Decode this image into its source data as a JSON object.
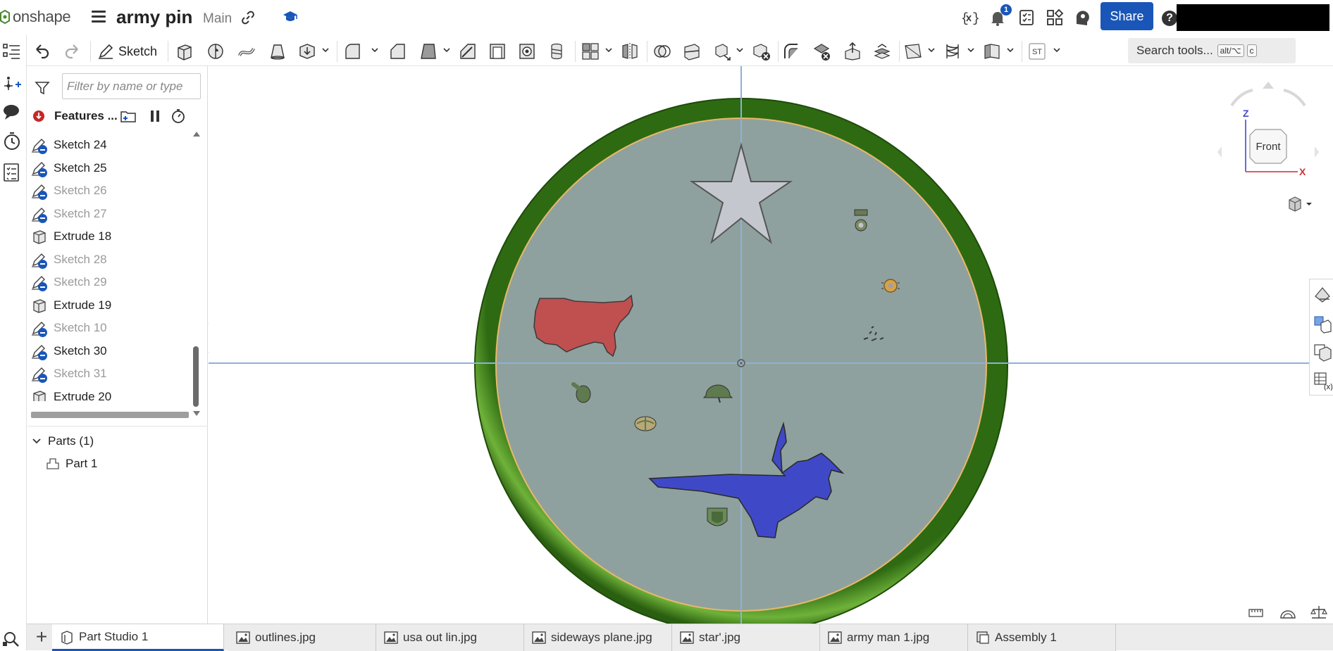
{
  "header": {
    "brand": "onshape",
    "doc_title": "army pin",
    "branch": "Main",
    "notification_count": "1",
    "share_label": "Share",
    "help_label": "?"
  },
  "toolbar": {
    "sketch_label": "Sketch",
    "st_label": "ST",
    "search_label": "Search tools...",
    "search_shortcut_a": "alt/⌥",
    "search_shortcut_b": "c"
  },
  "feature_panel": {
    "filter_placeholder": "Filter by name or type",
    "features_label": "Features ...",
    "items": [
      {
        "label": "Sketch 24",
        "kind": "sketch",
        "suppressed": false
      },
      {
        "label": "Sketch 25",
        "kind": "sketch",
        "suppressed": false
      },
      {
        "label": "Sketch 26",
        "kind": "sketch",
        "suppressed": true
      },
      {
        "label": "Sketch 27",
        "kind": "sketch",
        "suppressed": true
      },
      {
        "label": "Extrude 18",
        "kind": "extrude",
        "suppressed": false
      },
      {
        "label": "Sketch 28",
        "kind": "sketch",
        "suppressed": true
      },
      {
        "label": "Sketch 29",
        "kind": "sketch",
        "suppressed": true
      },
      {
        "label": "Extrude 19",
        "kind": "extrude",
        "suppressed": false
      },
      {
        "label": "Sketch 10",
        "kind": "sketch",
        "suppressed": true
      },
      {
        "label": "Sketch 30",
        "kind": "sketch",
        "suppressed": false
      },
      {
        "label": "Sketch 31",
        "kind": "sketch",
        "suppressed": true
      },
      {
        "label": "Extrude 20",
        "kind": "extrude",
        "suppressed": false
      }
    ],
    "parts_label": "Parts (1)",
    "part_label": "Part 1"
  },
  "view_cube": {
    "face_label": "Front",
    "axis_z": "Z",
    "axis_x": "X"
  },
  "tabs": [
    {
      "label": "Part Studio 1",
      "icon": "part-studio-icon",
      "active": true
    },
    {
      "label": "outlines.jpg",
      "icon": "image-icon",
      "active": false
    },
    {
      "label": "usa out lin.jpg",
      "icon": "image-icon",
      "active": false
    },
    {
      "label": "sideways plane.jpg",
      "icon": "image-icon",
      "active": false
    },
    {
      "label": "star'.jpg",
      "icon": "image-icon",
      "active": false
    },
    {
      "label": "army man 1.jpg",
      "icon": "image-icon",
      "active": false
    },
    {
      "label": "Assembly 1",
      "icon": "assembly-icon",
      "active": false
    }
  ],
  "colors": {
    "accent": "#1a56b8",
    "ring": "#3f8a1c",
    "disc": "#8fa19e",
    "usa": "#c05050",
    "plane": "#3f49c8",
    "star": "#c4c8ce",
    "suppressed_text": "#9a9a9a"
  }
}
